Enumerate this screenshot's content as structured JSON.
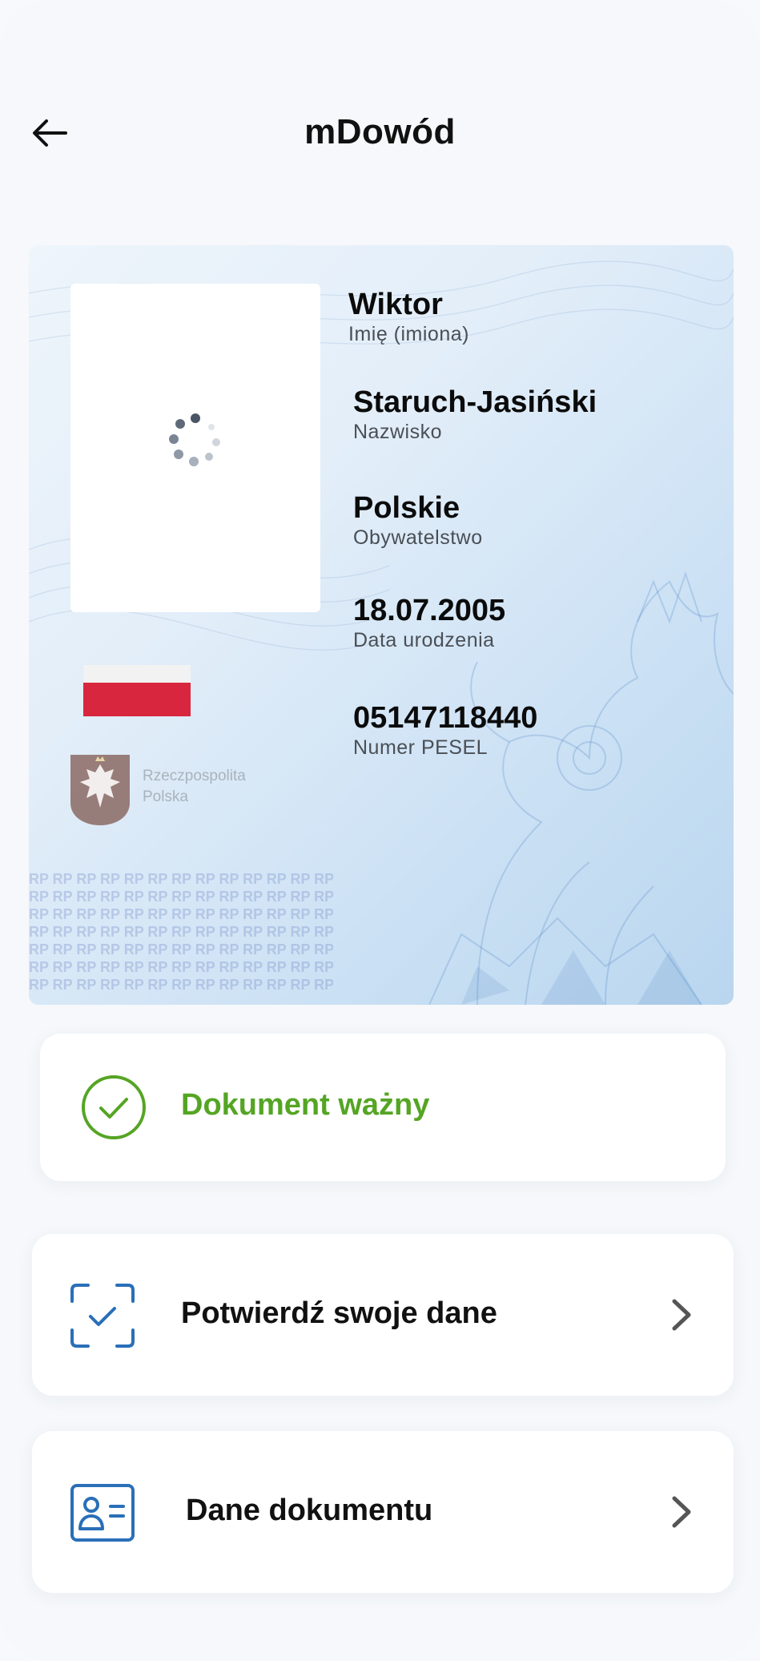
{
  "header": {
    "title": "mDowód",
    "back_icon": "arrow-left-icon"
  },
  "card": {
    "photo_state": "loading",
    "country_name_line1": "Rzeczpospolita",
    "country_name_line2": "Polska",
    "rp_pattern_text": "RP RP RP RP RP RP RP RP RP RP RP RP RP RP",
    "fields": [
      {
        "value": "Wiktor",
        "label": "Imię (imiona)"
      },
      {
        "value": "Staruch-Jasiński",
        "label": "Nazwisko"
      },
      {
        "value": "Polskie",
        "label": "Obywatelstwo"
      },
      {
        "value": "18.07.2005",
        "label": "Data urodzenia"
      },
      {
        "value": "05147118440",
        "label": "Numer PESEL"
      }
    ]
  },
  "status": {
    "text": "Dokument ważny",
    "icon": "check-circle-icon",
    "color": "#55a524"
  },
  "actions": [
    {
      "label": "Potwierdź swoje dane",
      "icon": "scan-check-icon"
    },
    {
      "label": "Dane dokumentu",
      "icon": "id-card-icon"
    }
  ],
  "colors": {
    "accent_blue": "#2a6fb8",
    "flag_red": "#d7263d",
    "valid_green": "#55a524"
  }
}
